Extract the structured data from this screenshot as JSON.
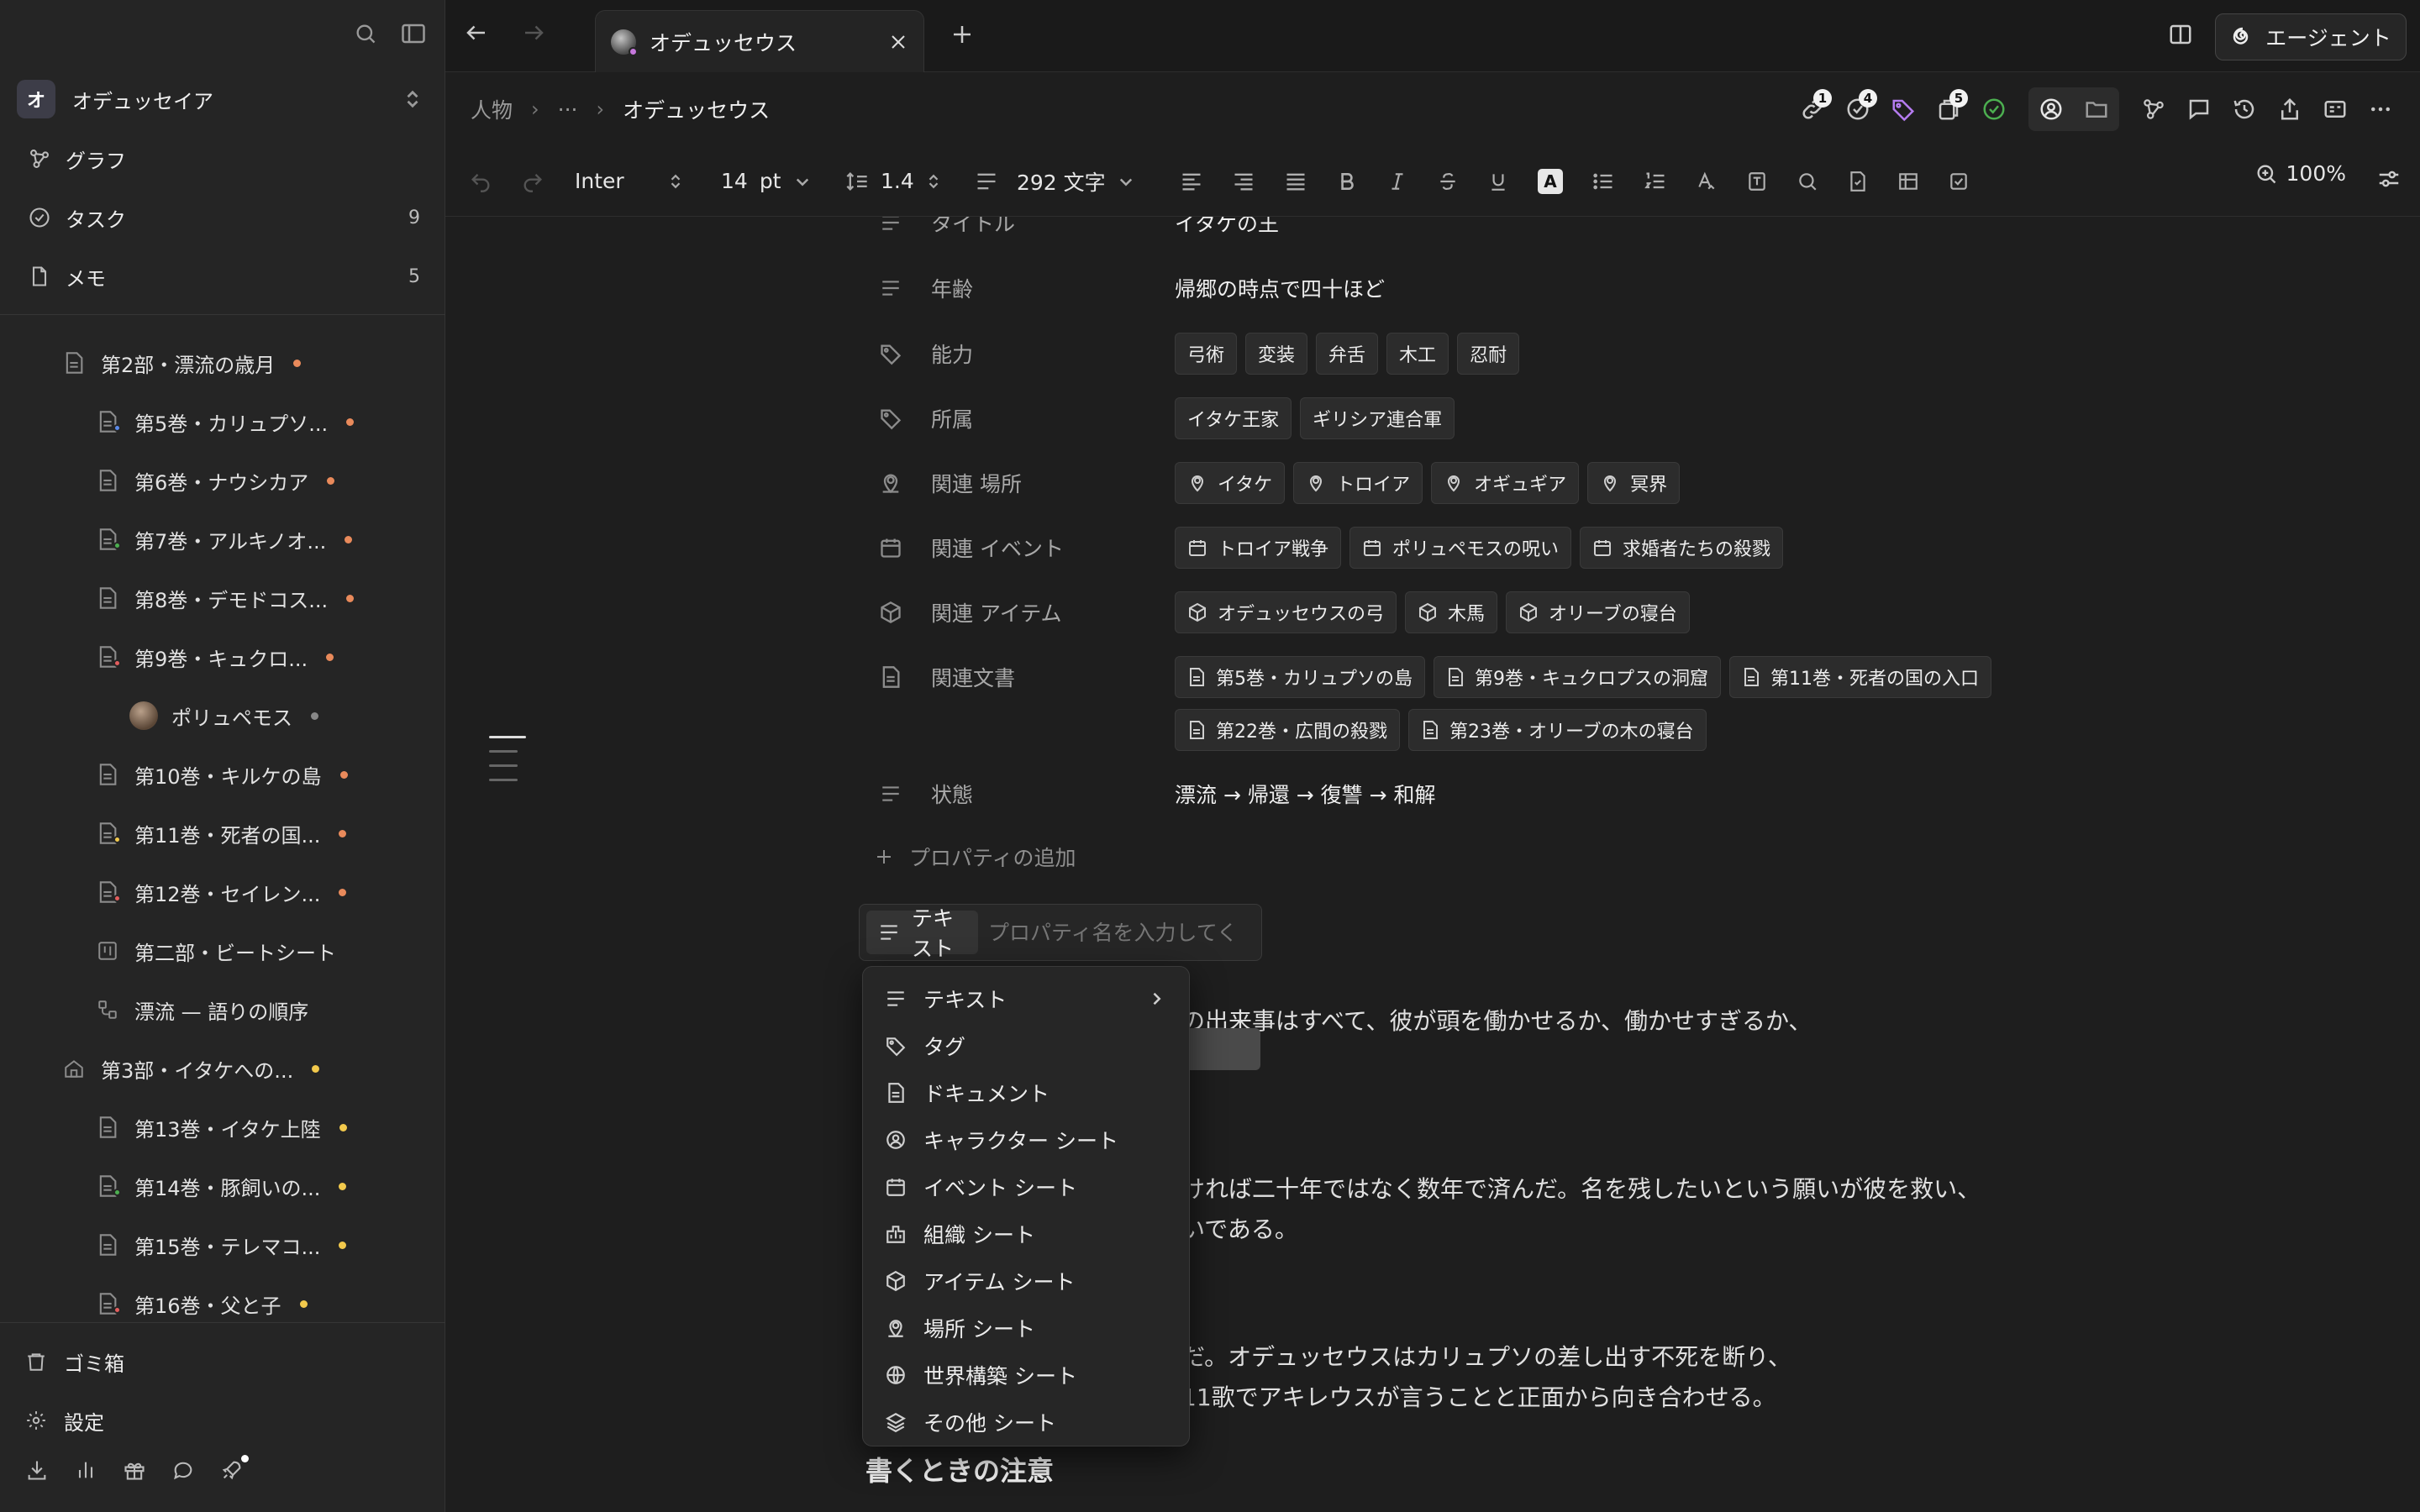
{
  "workspace": {
    "avatar_letter": "オ",
    "name": "オデュッセイア"
  },
  "nav": [
    {
      "label": "グラフ",
      "icon": "graph-icon",
      "count": ""
    },
    {
      "label": "タスク",
      "icon": "task-check-icon",
      "count": "9"
    },
    {
      "label": "メモ",
      "icon": "memo-icon",
      "count": "5"
    }
  ],
  "tree": [
    {
      "label": "第2部・漂流の歳月",
      "dot": "#e98a5b"
    },
    {
      "label": "第5巻・カリュプソ...",
      "dot": "#e98a5b",
      "mini": "#5b8ae9"
    },
    {
      "label": "第6巻・ナウシカア",
      "dot": "#e98a5b"
    },
    {
      "label": "第7巻・アルキノオ...",
      "dot": "#e98a5b",
      "mini": "#4caf50"
    },
    {
      "label": "第8巻・デモドコス...",
      "dot": "#e98a5b"
    },
    {
      "label": "第9巻・キュクロ...",
      "dot": "#e98a5b",
      "mini": "#e35d5d"
    },
    {
      "label": "ポリュペモス",
      "dot": "#888888"
    },
    {
      "label": "第10巻・キルケの島",
      "dot": "#e98a5b"
    },
    {
      "label": "第11巻・死者の国...",
      "dot": "#e98a5b",
      "mini": "#f2c94c"
    },
    {
      "label": "第12巻・セイレン...",
      "dot": "#e98a5b",
      "mini": "#e35d5d"
    },
    {
      "label": "第二部・ビートシート",
      "dot": ""
    },
    {
      "label": "漂流 — 語りの順序",
      "dot": ""
    },
    {
      "label": "第3部・イタケへの...",
      "dot": "#f2c94c"
    },
    {
      "label": "第13巻・イタケ上陸",
      "dot": "#f2c94c"
    },
    {
      "label": "第14巻・豚飼いの...",
      "dot": "#f2c94c",
      "mini": "#4caf50"
    },
    {
      "label": "第15巻・テレマコ...",
      "dot": "#f2c94c"
    },
    {
      "label": "第16巻・父と子",
      "dot": "#f2c94c",
      "mini": "#e35d5d"
    }
  ],
  "sidebar_bottom": {
    "trash": "ゴミ箱",
    "settings": "設定"
  },
  "tab": {
    "title": "オデュッセウス"
  },
  "agent_label": "エージェント",
  "breadcrumb": {
    "root": "人物",
    "ellipsis": "···",
    "current": "オデュッセウス"
  },
  "badges": {
    "links": "1",
    "tasks": "4",
    "docs": "5"
  },
  "toolbar": {
    "font": "Inter",
    "size": "14",
    "unit": "pt",
    "line_height": "1.4",
    "word_count": "292 文字",
    "zoom": "100%"
  },
  "properties": {
    "title": {
      "name": "タイトル",
      "value": "イタケの王"
    },
    "age": {
      "name": "年齢",
      "value": "帰郷の時点で四十ほど"
    },
    "ability": {
      "name": "能力",
      "chips": [
        "弓術",
        "変装",
        "弁舌",
        "木工",
        "忍耐"
      ]
    },
    "affiliation": {
      "name": "所属",
      "chips": [
        "イタケ王家",
        "ギリシア連合軍"
      ]
    },
    "places": {
      "name": "関連 場所",
      "chips": [
        "イタケ",
        "トロイア",
        "オギュギア",
        "冥界"
      ]
    },
    "events": {
      "name": "関連 イベント",
      "chips": [
        "トロイア戦争",
        "ポリュペモスの呪い",
        "求婚者たちの殺戮"
      ]
    },
    "items": {
      "name": "関連 アイテム",
      "chips": [
        "オデュッセウスの弓",
        "木馬",
        "オリーブの寝台"
      ]
    },
    "docs": {
      "name": "関連文書",
      "chips1": [
        "第5巻・カリュプソの島",
        "第9巻・キュクロプスの洞窟",
        "第11巻・死者の国の入口"
      ],
      "chips2": [
        "第22巻・広間の殺戮",
        "第23巻・オリーブの木の寝台"
      ]
    },
    "status": {
      "name": "状態",
      "value": "漂流 → 帰還 → 復讐 → 和解"
    }
  },
  "add_property": "プロパティの追加",
  "new_property": {
    "type_label": "テキスト",
    "placeholder": "プロパティ名を入力してく"
  },
  "type_menu": [
    {
      "label": "テキスト",
      "icon": "text-lines-icon"
    },
    {
      "label": "タグ",
      "icon": "tag-icon"
    },
    {
      "label": "ドキュメント",
      "icon": "document-icon"
    },
    {
      "label": "キャラクター シート",
      "icon": "character-icon"
    },
    {
      "label": "イベント シート",
      "icon": "calendar-icon"
    },
    {
      "label": "組織 シート",
      "icon": "organization-icon"
    },
    {
      "label": "アイテム シート",
      "icon": "box-icon"
    },
    {
      "label": "場所 シート",
      "icon": "location-icon"
    },
    {
      "label": "世界構築 シート",
      "icon": "globe-icon"
    },
    {
      "label": "その他 シート",
      "icon": "layers-icon"
    }
  ],
  "body": {
    "p1": "の出来事はすべて、彼が頭を働かせるか、働かせすぎるか、",
    "p2a": "ければ二十年ではなく数年で済んだ。名を残したいという願いが彼を救い、",
    "p2b": "いである。",
    "p3a": "だ。オデュッセウスはカリュプソの差し出す不死を断り、",
    "p3b": "11歌でアキレウスが言うことと正面から向き合わせる。",
    "heading": "書くときの注意"
  }
}
